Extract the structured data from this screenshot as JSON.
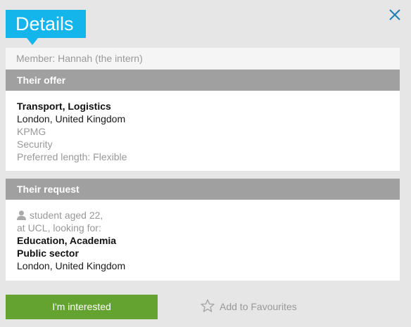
{
  "title": "Details",
  "member": "Member: Hannah (the intern)",
  "offer": {
    "heading": "Their offer",
    "sector": "Transport, Logistics",
    "location": "London, United Kingdom",
    "company": "KPMG",
    "department": "Security",
    "length": "Preferred length: Flexible"
  },
  "request": {
    "heading": "Their request",
    "student_line1": "student aged 22,",
    "student_line2": "at UCL, looking for:",
    "sector1": "Education, Academia",
    "sector2": "Public sector",
    "location": "London, United Kingdom"
  },
  "actions": {
    "interested_label": "I'm interested",
    "favourites_label": "Add to Favourites"
  },
  "icons": {
    "close": "close-icon",
    "person": "person-icon",
    "star": "star-icon"
  },
  "colors": {
    "title_bg": "#13b5ea",
    "close_icon": "#1a7fb5",
    "section_header_bg": "#a0a0a0",
    "cta_bg": "#65a330"
  }
}
